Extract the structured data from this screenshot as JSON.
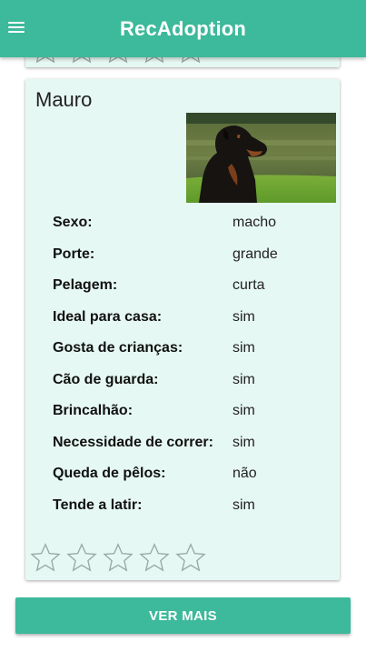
{
  "app": {
    "title": "RecAdoption"
  },
  "pet": {
    "name": "Mauro",
    "rating": 0,
    "attributes": [
      {
        "label": "Sexo:",
        "value": "macho"
      },
      {
        "label": "Porte:",
        "value": "grande"
      },
      {
        "label": "Pelagem:",
        "value": "curta"
      },
      {
        "label": "Ideal para casa:",
        "value": "sim"
      },
      {
        "label": "Gosta de crianças:",
        "value": "sim"
      },
      {
        "label": "Cão de guarda:",
        "value": "sim"
      },
      {
        "label": "Brincalhão:",
        "value": "sim"
      },
      {
        "label": "Necessidade de correr:",
        "value": "sim"
      },
      {
        "label": "Queda de pêlos:",
        "value": "não"
      },
      {
        "label": "Tende a latir:",
        "value": "sim"
      }
    ]
  },
  "actions": {
    "more_label": "VER MAIS"
  },
  "colors": {
    "primary": "#3db99b",
    "card_bg": "#e6f8f3",
    "star_outline": "#9aa8a4"
  },
  "icons": {
    "menu": "hamburger-menu-icon",
    "star": "star-outline-icon",
    "photo": "rottweiler-dog-photo"
  }
}
